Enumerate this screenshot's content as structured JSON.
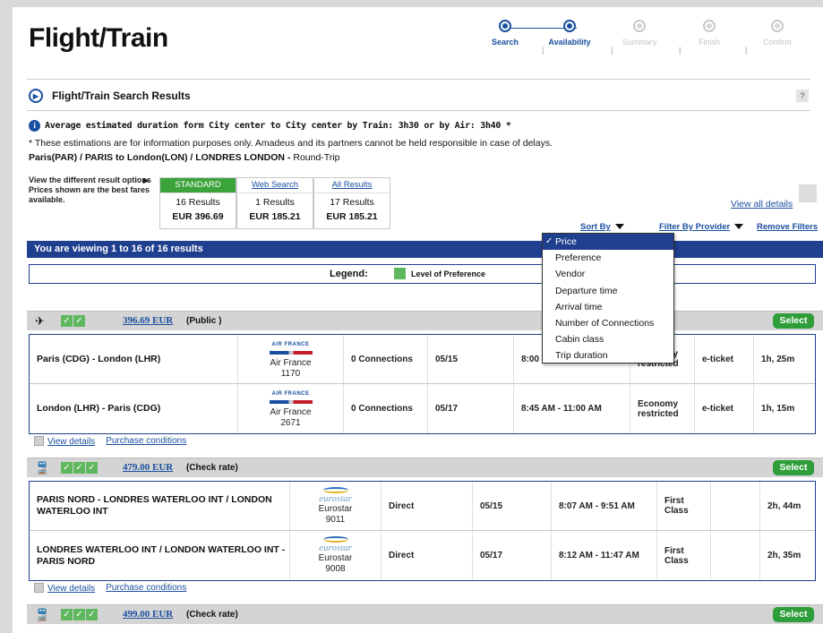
{
  "page_title": "Flight/Train",
  "steps": [
    {
      "label": "Search",
      "state": "done"
    },
    {
      "label": "Availability",
      "state": "current"
    },
    {
      "label": "Summary",
      "state": "off"
    },
    {
      "label": "Finish",
      "state": "off"
    },
    {
      "label": "Confirm",
      "state": "off"
    }
  ],
  "section_title": "Flight/Train Search Results",
  "help_label": "?",
  "info_text": "Average estimated duration form City center to City center by Train: 3h30 or by Air: 3h40 *",
  "note_text": "* These estimations are for information purposes only. Amadeus and its partners cannot be held responsible in case of delays.",
  "route": {
    "main": "Paris(PAR) / PARIS to London(LON) / LONDRES LONDON -",
    "trip": " Round-Trip"
  },
  "result_view": {
    "line1": "View the different result options",
    "line2": "Prices shown are the best fares available.",
    "arrow": "▶"
  },
  "result_options": [
    {
      "name": "STANDARD",
      "count": "16 Results",
      "price": "EUR 396.69",
      "active": true
    },
    {
      "name": "Web Search",
      "count": "1 Results",
      "price": "EUR 185.21",
      "active": false
    },
    {
      "name": "All Results",
      "count": "17 Results",
      "price": "EUR 185.21",
      "active": false
    }
  ],
  "view_all_details": "View all details",
  "toolbar": {
    "sort_by": "Sort By",
    "filter_by_provider": "Filter By Provider",
    "remove_filters": "Remove Filters"
  },
  "results_bar": "You are viewing 1 to 16 of 16 results",
  "legend": {
    "label": "Legend:",
    "item": "Level of Preference",
    "color": "#5fb85f"
  },
  "select_label": "Select",
  "view_details": "View details",
  "purchase_conditions": "Purchase conditions",
  "groups": [
    {
      "icon": "✈",
      "price": "396.69 EUR",
      "type": "(Public )",
      "rows": [
        {
          "route": "Paris (CDG) - London (LHR)",
          "carrier": "Air France",
          "number": "1170",
          "connections": "0 Connections",
          "date": "05/15",
          "time": "8:00",
          "class": "Economy restricted",
          "ticket": "e-ticket",
          "duration": "1h, 25m"
        },
        {
          "route": "London (LHR) - Paris (CDG)",
          "carrier": "Air France",
          "number": "2671",
          "connections": "0 Connections",
          "date": "05/17",
          "time": "8:45 AM - 11:00 AM",
          "class": "Economy restricted",
          "ticket": "e-ticket",
          "duration": "1h, 15m"
        }
      ]
    },
    {
      "icon": "🚆",
      "price": "479.00 EUR",
      "type": "(Check rate)",
      "rows": [
        {
          "route": "PARIS NORD - LONDRES WATERLOO INT / LONDON WATERLOO INT",
          "carrier": "Eurostar",
          "number": "9011",
          "connections": "Direct",
          "date": "05/15",
          "time": "8:07 AM - 9:51 AM",
          "class": "First Class",
          "ticket": "",
          "duration": "2h, 44m"
        },
        {
          "route": "LONDRES WATERLOO INT / LONDON WATERLOO INT - PARIS NORD",
          "carrier": "Eurostar",
          "number": "9008",
          "connections": "Direct",
          "date": "05/17",
          "time": "8:12 AM - 11:47 AM",
          "class": "First Class",
          "ticket": "",
          "duration": "2h, 35m"
        }
      ]
    },
    {
      "icon": "🚆",
      "price": "499.00 EUR",
      "type": "(Check rate)",
      "rows": []
    }
  ],
  "logos": {
    "air_france": "AIR FRANCE",
    "eurostar": "eurostar"
  },
  "sort_dropdown": {
    "selected": "Price",
    "options": [
      "Price",
      "Preference",
      "Vendor",
      "Departure time",
      "Arrival time",
      "Number of Connections",
      "Cabin class",
      "Trip duration"
    ]
  }
}
